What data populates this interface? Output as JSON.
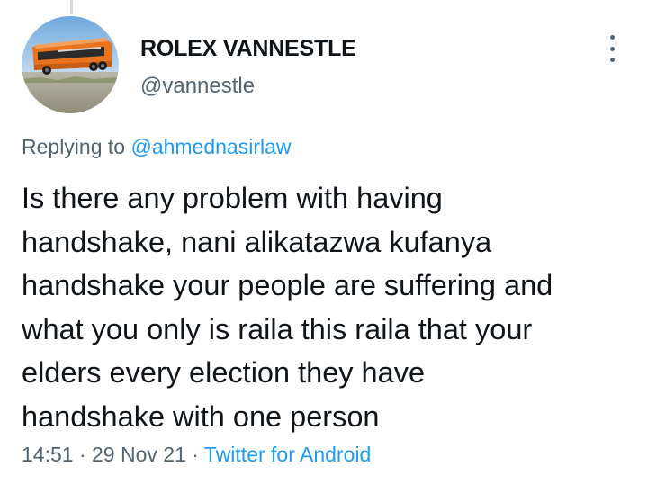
{
  "user": {
    "display_name": "ROLEX VANNESTLE",
    "handle": "@vannestle",
    "avatar": "profile-photo-bus"
  },
  "tweet": {
    "replying_prefix": "Replying to",
    "replying_to": "@ahmednasirlaw",
    "text_lines": [
      "Is there any problem with having",
      "handshake, nani alikatazwa kufanya",
      "handshake your people are suffering and",
      "what you only is raila this raila that your",
      "elders every election they have",
      "handshake with one person"
    ],
    "time": "14:51",
    "separator": "·",
    "date": "29 Nov 21",
    "source": "Twitter for Android"
  },
  "icons": {
    "more": "more-vertical-icon"
  },
  "colors": {
    "text": "#0f1419",
    "secondary": "#536471",
    "link": "#1d9bf0",
    "thread_line": "#cfd9de"
  }
}
